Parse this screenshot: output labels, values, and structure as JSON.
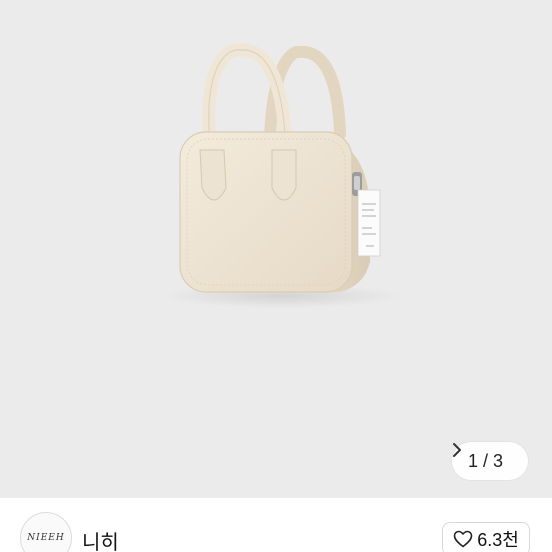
{
  "gallery": {
    "current_page": 1,
    "total_pages": 3,
    "counter_text": "1 / 3",
    "next_icon": "chevron-right-icon",
    "product_image": "cream-leather-top-handle-bag",
    "background_color": "#ebebeb",
    "bag_color": "#ede3d2"
  },
  "seller": {
    "avatar_text": "NIEEH",
    "name": "니히"
  },
  "like": {
    "icon": "heart-outline-icon",
    "count": "6.3천"
  }
}
